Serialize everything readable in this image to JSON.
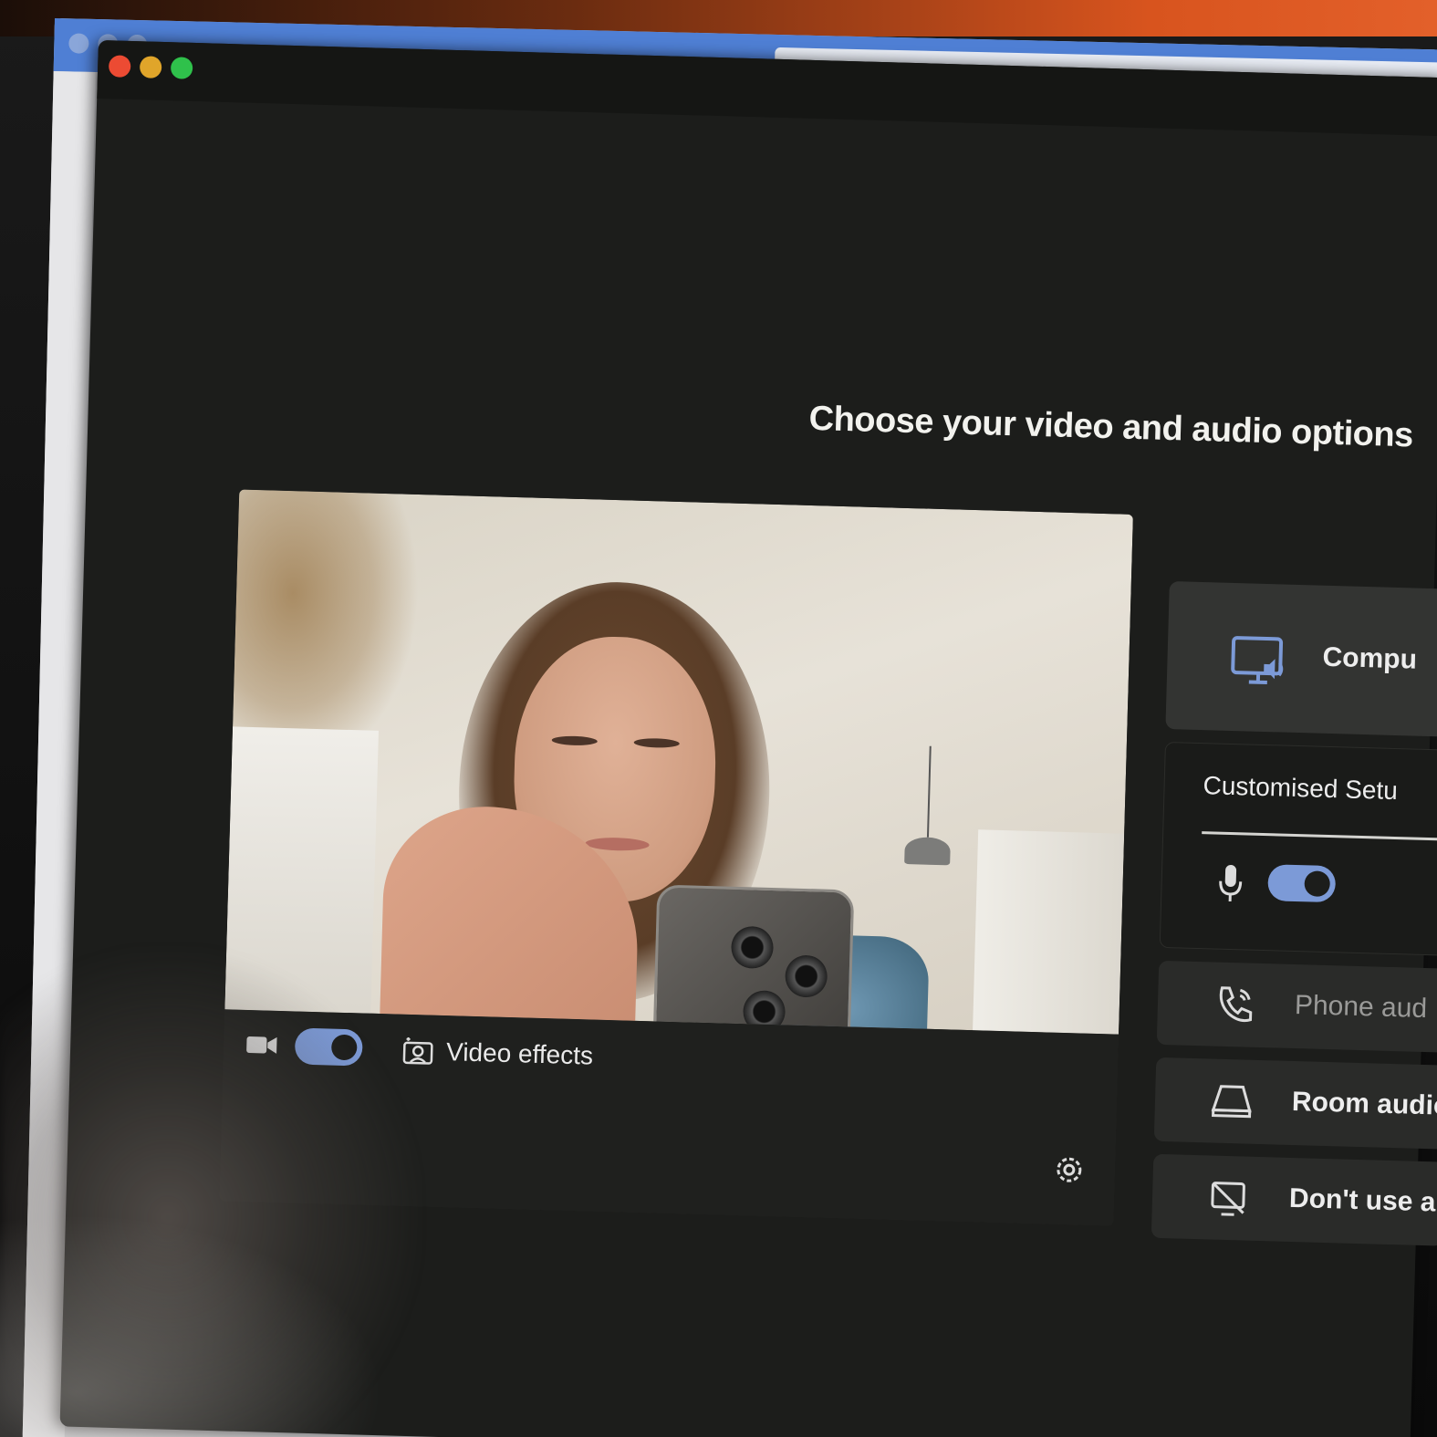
{
  "window": {
    "controls": [
      "close",
      "minimize",
      "maximize"
    ]
  },
  "heading": "Choose your video and audio options",
  "preview": {
    "camera_icon": "video-camera-icon",
    "video_enabled": true,
    "effects_label": "Video effects",
    "effects_icon": "video-effects-icon",
    "settings_icon": "gear-icon"
  },
  "audio_options": {
    "computer": {
      "label": "Compu",
      "icon": "computer-audio-icon"
    },
    "custom": {
      "label": "Customised Setu",
      "mic_icon": "microphone-icon",
      "mic_enabled": true
    },
    "phone": {
      "label": "Phone aud",
      "icon": "phone-audio-icon"
    },
    "room": {
      "label": "Room audio",
      "icon": "room-audio-icon"
    },
    "none": {
      "label": "Don't use au",
      "icon": "no-audio-icon"
    }
  },
  "colors": {
    "accent": "#7c9ad7",
    "background": "#1c1d1b",
    "text": "#eaeaea"
  }
}
